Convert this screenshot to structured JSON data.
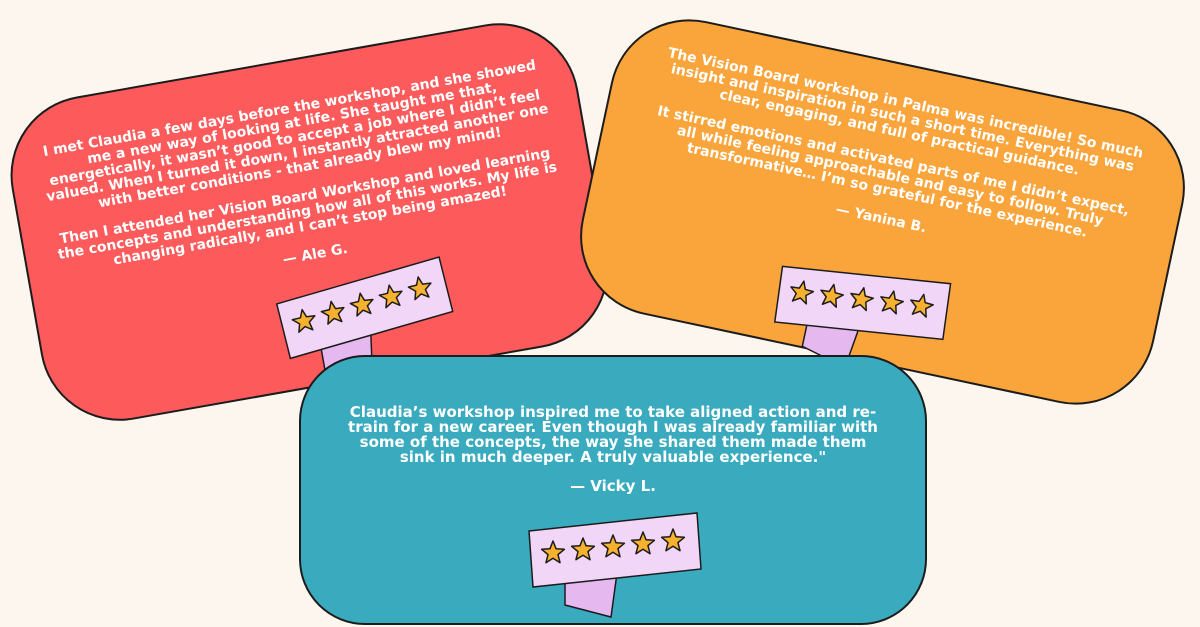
{
  "colors": {
    "background": "#FDF6EF",
    "card_red": "#FC5A5B",
    "card_orange": "#FAA43C",
    "card_teal": "#3AABBF",
    "ribbon": "#F2D6F7",
    "ribbon_fold": "#E6B8F0",
    "star": "#F6B12F",
    "outline": "#1C1C1C"
  },
  "testimonials": [
    {
      "paragraphs": [
        "I met Claudia a few days before the workshop, and she showed me a new way of looking at life. She taught me that, energetically, it wasn’t good to accept a job where I didn’t feel valued. When I turned it down, I instantly attracted another one with better conditions - that already blew my mind!",
        "Then I attended her Vision Board Workshop and loved learning the concepts and understanding how all of this works. My life is changing radically, and I can’t stop being amazed!"
      ],
      "author": "— Ale G.",
      "rating": 5
    },
    {
      "paragraphs": [
        "The Vision Board workshop in Palma was incredible! So much insight and inspiration in such a short time. Everything was clear, engaging, and full of practical guidance.",
        "It stirred emotions and activated parts of me I didn’t expect, all while feeling approachable and easy to follow. Truly transformative… I’m so grateful for the experience."
      ],
      "author": "— Yanina B.",
      "rating": 5
    },
    {
      "paragraphs": [
        "Claudia’s workshop inspired me to take aligned action and re-train for a new career. Even though I was already familiar with some of the concepts, the way she shared them made them sink in much deeper. A truly valuable experience.\""
      ],
      "author": "— Vicky L.",
      "rating": 5
    }
  ],
  "icons": {
    "star": "star-icon",
    "ribbon": "ribbon-banner"
  }
}
